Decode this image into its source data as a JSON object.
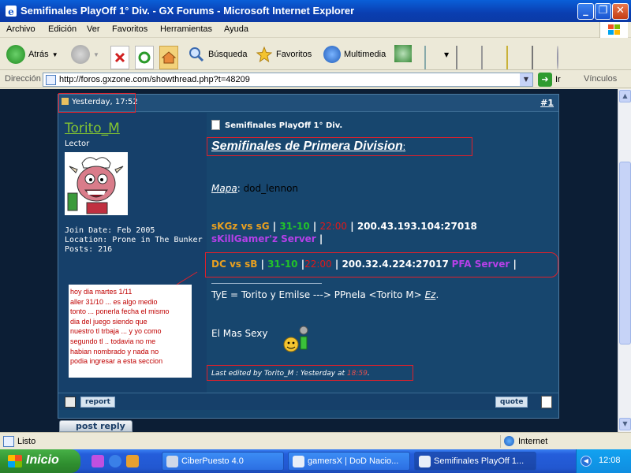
{
  "window": {
    "title": "Semifinales PlayOff 1° Div. - GX Forums - Microsoft Internet Explorer",
    "minimize": "_",
    "maximize": "❐",
    "close": "✕"
  },
  "menu": [
    "Archivo",
    "Edición",
    "Ver",
    "Favoritos",
    "Herramientas",
    "Ayuda"
  ],
  "toolbar": {
    "back": "Atrás",
    "search": "Búsqueda",
    "favorites": "Favoritos",
    "multimedia": "Multimedia"
  },
  "address": {
    "label": "Dirección",
    "url": "http://foros.gxzone.com/showthread.php?t=48209",
    "go": "Ir",
    "links": "Vínculos"
  },
  "post": {
    "date": "Yesterday, 17:52",
    "number": "#1",
    "username": "Torito_M",
    "user_title": "Lector",
    "join_date": "Join Date: Feb 2005",
    "location": "Location: Prone in The Bunker",
    "posts": "Posts: 216",
    "note_lines": [
      "hoy dia martes 1/11",
      "aller 31/10 ... es algo medio",
      "tonto ... ponerla fecha el mismo",
      "dia del juego siendo que",
      "nuestro tl trbaja ... y yo como",
      "segundo tl .. todavia no me",
      "habian nombrado y nada no",
      "podia ingresar a esta seccion"
    ],
    "subject": "Semifinales PlayOff 1° Div.",
    "big_title": "Semifinales de Primera Division",
    "big_title_colon": ":",
    "map_label": "Mapa",
    "map_colon": ":",
    "map_value": "dod_lennon",
    "match1": {
      "teams": "sKGz vs sG",
      "sep1": " | ",
      "date": "31-10",
      "sep2": " | ",
      "time": "22:00",
      "sep3": " | ",
      "server": "200.43.193.104:27018",
      "server_name": "sKillGamer'z Server",
      "trail": " |"
    },
    "match2": {
      "teams": "DC vs sB",
      "sep1": " | ",
      "date": "31-10",
      "sep2": " |",
      "time": "22:00",
      "sep3": " | ",
      "server": "200.32.4.224:27017",
      "server_name": "PFA Server",
      "trail": " |"
    },
    "tye_text": "TyE = Torito y Emilse ---> PPnela <Torito M>",
    "tye_link": "Ez",
    "tye_end": ".",
    "sexy": "El Mas Sexy",
    "last_edited_prefix": "Last edited by Torito_M : Yesterday at",
    "last_edited_time": "18:59",
    "last_edited_end": ".",
    "report": "report",
    "quote": "quote",
    "post_reply": "post reply"
  },
  "status": {
    "text": "Listo",
    "zone": "Internet"
  },
  "taskbar": {
    "start": "Inicio",
    "tasks": [
      "CiberPuesto 4.0",
      "gamersX | DoD Nacio...",
      "Semifinales PlayOff 1..."
    ],
    "clock": "12:08"
  }
}
